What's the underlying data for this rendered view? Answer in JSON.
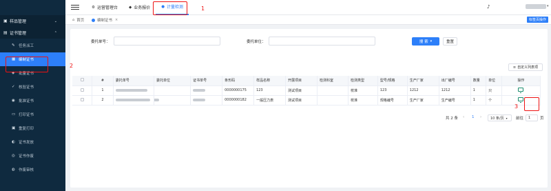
{
  "header": {
    "tabs": [
      {
        "label": "运营管理台",
        "icon": "gear-icon"
      },
      {
        "label": "业务报价",
        "icon": "diamond-icon"
      },
      {
        "label": "计量检测",
        "icon": "user-icon"
      }
    ]
  },
  "sidebar": {
    "groups": [
      {
        "label": "样品管理",
        "icon": "box-icon",
        "expanded": false
      },
      {
        "label": "证书管理",
        "icon": "certificate-icon",
        "expanded": true
      }
    ],
    "items": [
      {
        "label": "任务派工",
        "icon": "wrench-icon"
      },
      {
        "label": "编制证书",
        "icon": "edit-icon",
        "active": true
      },
      {
        "label": "批量证书",
        "icon": "layers-icon"
      },
      {
        "label": "核验证书",
        "icon": "check-icon"
      },
      {
        "label": "批准证书",
        "icon": "approve-icon"
      },
      {
        "label": "打印证书",
        "icon": "print-icon"
      },
      {
        "label": "重复打印",
        "icon": "reprint-icon"
      },
      {
        "label": "证书发放",
        "icon": "send-icon"
      },
      {
        "label": "证书作废",
        "icon": "void-icon"
      },
      {
        "label": "作废审核",
        "icon": "audit-icon"
      }
    ]
  },
  "page_tabs": {
    "home": "首页",
    "current": "编制证书",
    "right_button": "标签页操作"
  },
  "search": {
    "order_no_label": "委托单号：",
    "unit_label": "委托单位：",
    "search_button": "搜 索",
    "reset_button": "重置"
  },
  "custom_columns_button": "自定义列表项",
  "table": {
    "columns": [
      "",
      "#",
      "委托单号",
      "委托单位",
      "证书单号",
      "条形码",
      "样品名称",
      "开展项目",
      "检测科室",
      "检测类型",
      "型号/规格",
      "生产厂家",
      "出厂编号",
      "数量",
      "单位",
      "操作"
    ],
    "rows": [
      {
        "index": "1",
        "barcode": "0000000175",
        "sample": "123",
        "project": "测试项目",
        "dept": "",
        "type": "校准",
        "model": "123",
        "maker": "1212",
        "serial": "1212",
        "qty": "1",
        "unit": "只"
      },
      {
        "index": "2",
        "barcode": "0000000182",
        "sample": "一般压力表",
        "project": "测试项目",
        "dept": "",
        "type": "校准",
        "model": "规格编号",
        "maker": "生产厂家",
        "serial": "生产编号",
        "qty": "1",
        "unit": "个"
      }
    ]
  },
  "pagination": {
    "total": "共 2 条",
    "prev": "‹",
    "current_page": "1",
    "next": "›",
    "page_size": "10 条/页",
    "goto_label": "前往",
    "goto_value": "1",
    "page_unit": "页"
  },
  "annotations": [
    "1",
    "2",
    "3"
  ],
  "colors": {
    "accent": "#2d7ff9",
    "sidebar": "#0f2a3f",
    "annotation": "#ee1111"
  }
}
